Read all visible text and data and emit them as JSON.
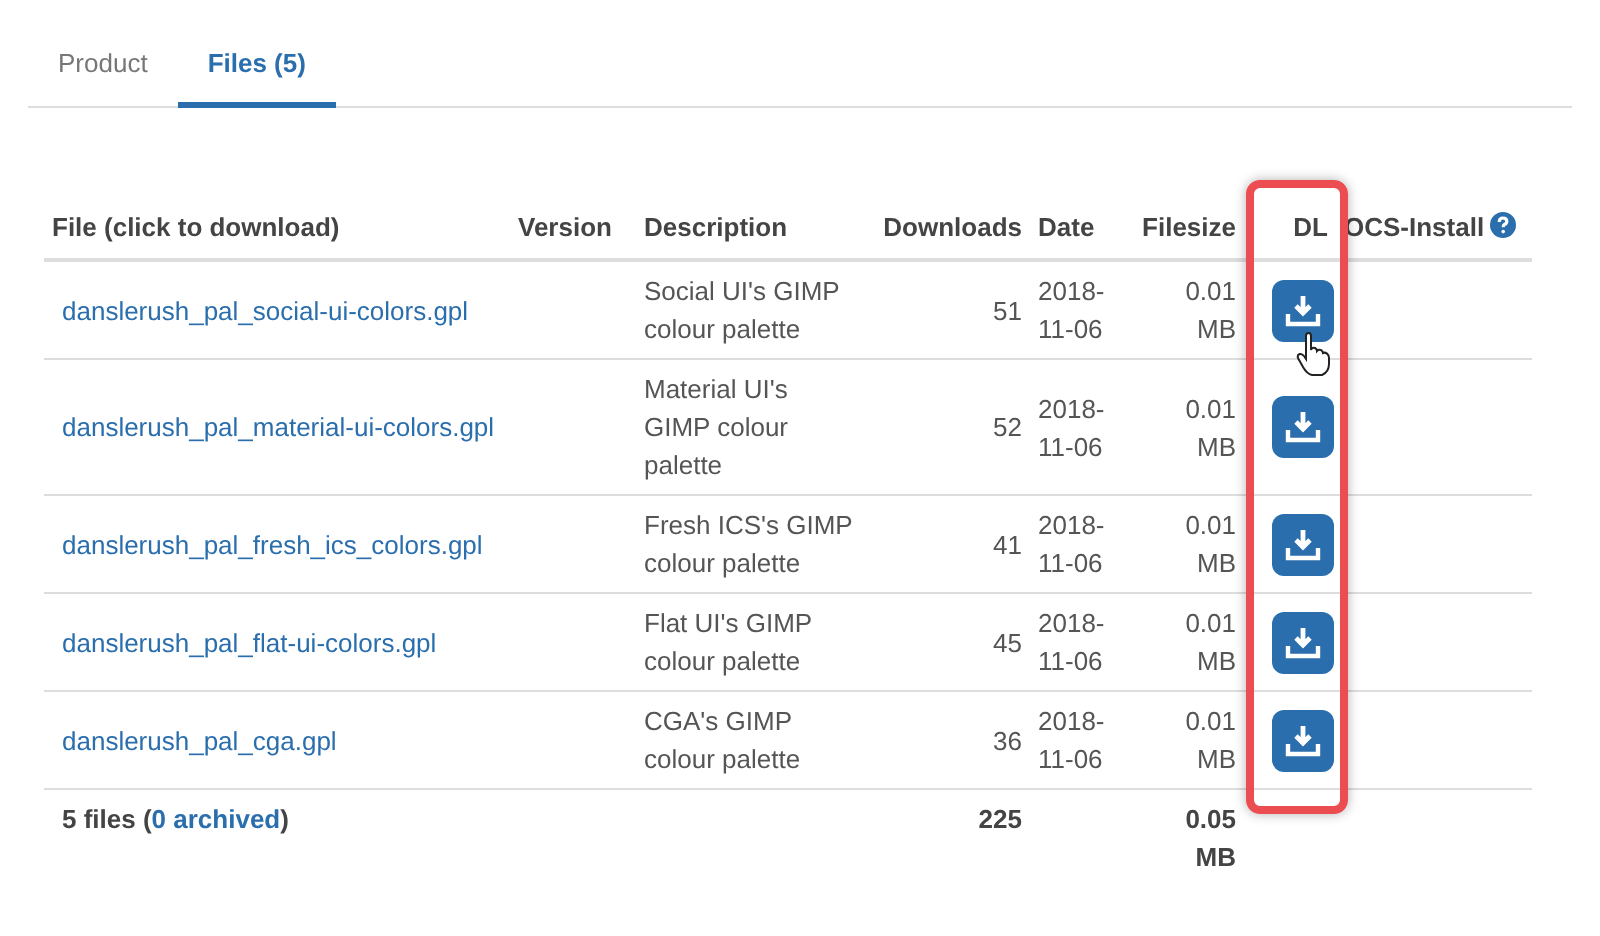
{
  "tabs": [
    {
      "label": "Product",
      "selected": false
    },
    {
      "label": "Files (5)",
      "selected": true
    }
  ],
  "table": {
    "columns": [
      "File (click to download)",
      "Version",
      "Description",
      "Downloads",
      "Date",
      "Filesize",
      "DL",
      "OCS-Install"
    ],
    "rows": [
      {
        "file": "danslerush_pal_social-ui-colors.gpl",
        "description": "Social UI's GIMP colour palette",
        "downloads": "51",
        "date": "2018-11-06",
        "filesize": "0.01 MB"
      },
      {
        "file": "danslerush_pal_material-ui-colors.gpl",
        "description": "Material UI's GIMP colour palette",
        "downloads": "52",
        "date": "2018-11-06",
        "filesize": "0.01 MB"
      },
      {
        "file": "danslerush_pal_fresh_ics_colors.gpl",
        "description": "Fresh ICS's GIMP colour palette",
        "downloads": "41",
        "date": "2018-11-06",
        "filesize": "0.01 MB"
      },
      {
        "file": "danslerush_pal_flat-ui-colors.gpl",
        "description": "Flat UI's GIMP colour palette",
        "downloads": "45",
        "date": "2018-11-06",
        "filesize": "0.01 MB"
      },
      {
        "file": "danslerush_pal_cga.gpl",
        "description": "CGA's GIMP colour palette",
        "downloads": "36",
        "date": "2018-11-06",
        "filesize": "0.01 MB"
      }
    ],
    "footer": {
      "prefix": "5 files (",
      "archived_link": "0 archived",
      "suffix": ")",
      "downloads_total": "225",
      "filesize_total": "0.05 MB"
    }
  }
}
